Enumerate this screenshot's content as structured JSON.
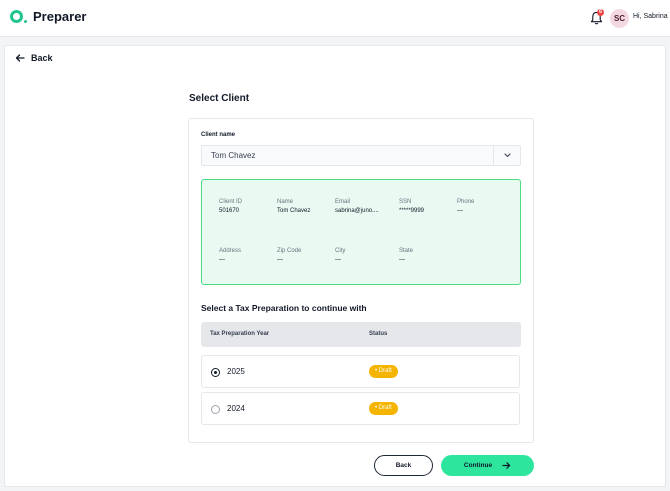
{
  "app": {
    "name": "Preparer"
  },
  "header": {
    "notification_count": "6",
    "avatar_initials": "SC",
    "greeting": "Hi, Sabrina"
  },
  "nav": {
    "back_label": "Back"
  },
  "page": {
    "title": "Select Client"
  },
  "client_select": {
    "label": "Client name",
    "value": "Tom Chavez"
  },
  "client_info": [
    {
      "key": "Client ID",
      "value": "501670"
    },
    {
      "key": "Name",
      "value": "Tom Chavez"
    },
    {
      "key": "Email",
      "value": "sabrina@juno...."
    },
    {
      "key": "SSN",
      "value": "*****9999"
    },
    {
      "key": "Phone",
      "value": "—"
    },
    {
      "key": "Address",
      "value": "—"
    },
    {
      "key": "Zip Code",
      "value": "—"
    },
    {
      "key": "City",
      "value": "—"
    },
    {
      "key": "State",
      "value": "—"
    }
  ],
  "tax_prep": {
    "title": "Select a Tax Preparation to continue with",
    "columns": [
      "Tax Preparation Year",
      "Status"
    ],
    "rows": [
      {
        "year": "2025",
        "status": "• Draft",
        "selected": true
      },
      {
        "year": "2024",
        "status": "• Draft",
        "selected": false
      }
    ]
  },
  "actions": {
    "back_label": "Back",
    "continue_label": "Continue"
  },
  "colors": {
    "accent": "#2ee59d",
    "brand": "#22c58b",
    "draft": "#f4b400",
    "info_bg": "#e8faf1",
    "info_border": "#4ade80"
  }
}
